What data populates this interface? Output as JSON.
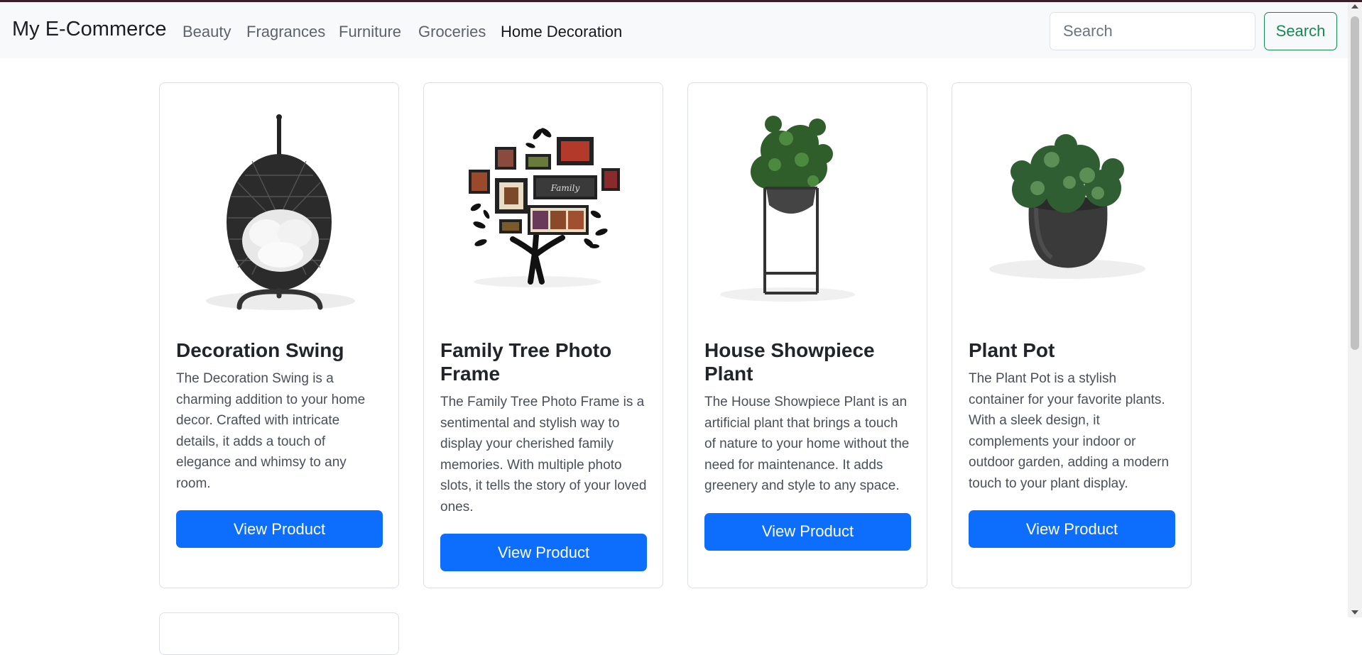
{
  "navbar": {
    "brand": "My E-Commerce",
    "links": [
      {
        "label": "Beauty",
        "active": false
      },
      {
        "label": "Fragrances",
        "active": false
      },
      {
        "label": "Furniture",
        "active": false
      },
      {
        "label": "Groceries",
        "active": false
      },
      {
        "label": "Home Decoration",
        "active": true
      }
    ]
  },
  "search": {
    "placeholder": "Search",
    "value": "",
    "button_label": "Search"
  },
  "products": [
    {
      "title": "Decoration Swing",
      "description": "The Decoration Swing is a charming addition to your home decor. Crafted with intricate details, it adds a touch of elegance and whimsy to any room.",
      "button_label": "View Product",
      "image": "decoration-swing-image"
    },
    {
      "title": "Family Tree Photo Frame",
      "description": "The Family Tree Photo Frame is a sentimental and stylish way to display your cherished family memories. With multiple photo slots, it tells the story of your loved ones.",
      "button_label": "View Product",
      "image": "family-tree-photo-frame-image",
      "image_text": "Family"
    },
    {
      "title": "House Showpiece Plant",
      "description": "The House Showpiece Plant is an artificial plant that brings a touch of nature to your home without the need for maintenance. It adds greenery and style to any space.",
      "button_label": "View Product",
      "image": "house-showpiece-plant-image"
    },
    {
      "title": "Plant Pot",
      "description": "The Plant Pot is a stylish container for your favorite plants. With a sleek design, it complements your indoor or outdoor garden, adding a modern touch to your plant display.",
      "button_label": "View Product",
      "image": "plant-pot-image"
    }
  ],
  "colors": {
    "primary": "#0d6efd",
    "success": "#198754",
    "navbar_bg": "#f8f9fa",
    "top_border": "#3a1f2b"
  }
}
